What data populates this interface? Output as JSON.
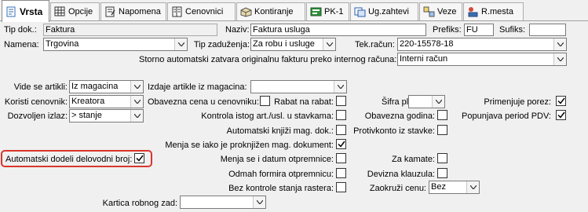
{
  "tabs": [
    {
      "label": "Vrsta",
      "icon": "document-icon"
    },
    {
      "label": "Opcije",
      "icon": "grid-icon"
    },
    {
      "label": "Napomena",
      "icon": "notepad-icon"
    },
    {
      "label": "Cenovnici",
      "icon": "book-icon"
    },
    {
      "label": "Kontiranje",
      "icon": "ledger-icon"
    },
    {
      "label": "PK-1",
      "icon": "database-icon"
    },
    {
      "label": "Ug.zahtevi",
      "icon": "contract-icon"
    },
    {
      "label": "Veze",
      "icon": "links-icon"
    },
    {
      "label": "R.mesta",
      "icon": "workplace-icon"
    }
  ],
  "form": {
    "tip_dok": {
      "label": "Tip dok.:",
      "value": "Faktura"
    },
    "naziv": {
      "label": "Naziv:",
      "value": "Faktura usluga"
    },
    "prefiks": {
      "label": "Prefiks:",
      "value": "FU"
    },
    "sufiks": {
      "label": "Sufiks:",
      "value": ""
    },
    "namena": {
      "label": "Namena:",
      "value": "Trgovina"
    },
    "tip_zaduzenja": {
      "label": "Tip zaduženja:",
      "value": "Za robu i usluge"
    },
    "tek_racun": {
      "label": "Tek.račun:",
      "value": "220-15578-18"
    },
    "storno": {
      "label": "Storno automatski zatvara originalnu fakturu preko internog računa:",
      "value": "Interni račun"
    },
    "vide_se_artikli": {
      "label": "Vide se artikli:",
      "value": "Iz magacina"
    },
    "izdaje_artikle": {
      "label": "Izdaje artikle iz magacina:",
      "value": ""
    },
    "koristi_cenovnik": {
      "label": "Koristi cenovnik:",
      "value": "Kreatora"
    },
    "dozvoljen_izlaz": {
      "label": "Dozvoljen izlaz:",
      "value": "> stanje"
    },
    "obavezna_cena": {
      "label": "Obavezna cena u cenovniku:",
      "checked": false
    },
    "rabat_na_rabat": {
      "label": "Rabat na rabat:",
      "checked": false
    },
    "sifra_pl": {
      "label": "Šifra pl.:",
      "value": ""
    },
    "primenjuje_porez": {
      "label": "Primenjuje porez:",
      "checked": true
    },
    "kontrola_istog": {
      "label": "Kontrola istog art./usl. u stavkama:",
      "checked": false
    },
    "obavezna_godina": {
      "label": "Obavezna godina:",
      "checked": false
    },
    "popunjava_period": {
      "label": "Popunjava period PDV:",
      "checked": true
    },
    "automatski_knjizi": {
      "label": "Automatski knjiži mag. dok.:",
      "checked": false
    },
    "protivkonto": {
      "label": "Protivkonto iz stavke:",
      "checked": false
    },
    "menja_se_iako": {
      "label": "Menja se iako je proknjižen mag. dokument:",
      "checked": true
    },
    "automatski_dodeli": {
      "label": "Automatski dodeli delovodni broj:",
      "checked": true
    },
    "menja_se_datum": {
      "label": "Menja se i datum otpremnice:",
      "checked": false
    },
    "za_kamate": {
      "label": "Za kamate:",
      "checked": false
    },
    "odmah_formira": {
      "label": "Odmah formira otpremnicu:",
      "checked": false
    },
    "devizna_klauzula": {
      "label": "Devizna klauzula:",
      "checked": false
    },
    "bez_kontrole": {
      "label": "Bez kontrole stanja rastera:",
      "checked": false
    },
    "zaokruzi_cenu": {
      "label": "Zaokruži cenu:",
      "value": "Bez"
    },
    "kartica_robnog": {
      "label": "Kartica robnog zad:",
      "value": ""
    }
  },
  "colors": {
    "highlight": "#d9362c"
  }
}
